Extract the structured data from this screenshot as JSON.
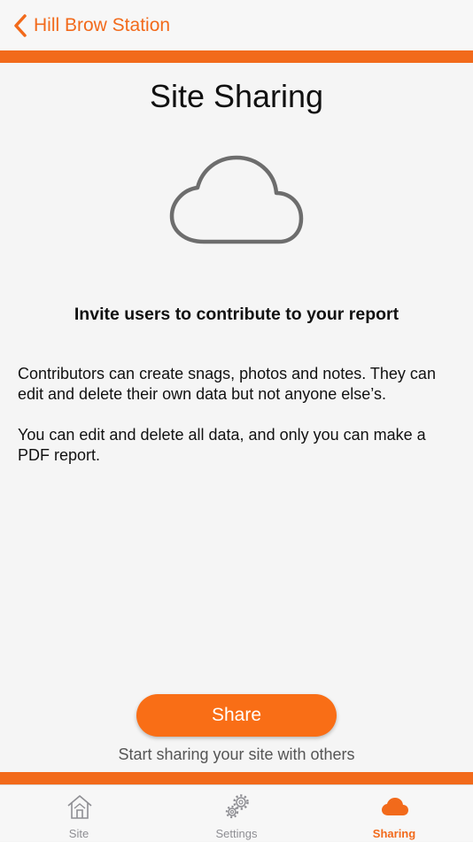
{
  "nav": {
    "back_label": "Hill Brow Station"
  },
  "page": {
    "title": "Site Sharing",
    "subtitle": "Invite users to contribute to your report",
    "paragraphs": [
      "Contributors can create snags, photos and notes. They can edit and delete their own data but not anyone else’s.",
      "You can edit and delete all data, and only you can make a PDF report."
    ],
    "share_button": "Share",
    "share_hint": "Start sharing your site with others"
  },
  "tabs": [
    {
      "label": "Site",
      "icon": "house-icon"
    },
    {
      "label": "Settings",
      "icon": "gears-icon"
    },
    {
      "label": "Sharing",
      "icon": "cloud-icon",
      "active": true
    }
  ],
  "colors": {
    "accent": "#f26a1b",
    "button": "#f96e16"
  }
}
